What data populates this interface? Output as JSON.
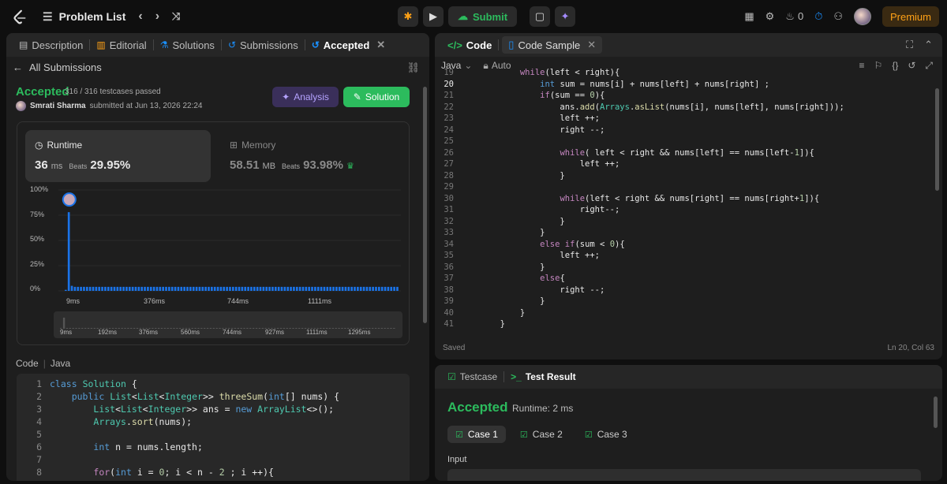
{
  "topbar": {
    "problem_list": "Problem List",
    "submit": "Submit",
    "streak": "0",
    "premium": "Premium"
  },
  "left": {
    "tabs": [
      {
        "label": "Description"
      },
      {
        "label": "Editorial"
      },
      {
        "label": "Solutions"
      },
      {
        "label": "Submissions"
      },
      {
        "label": "Accepted"
      }
    ],
    "back": "All Submissions",
    "status": "Accepted",
    "testcases": "316 / 316 testcases passed",
    "author": "Smrati Sharma",
    "submitted": "submitted at Jun 13, 2026 22:24",
    "analysis": "Analysis",
    "solution": "Solution",
    "runtime": {
      "label": "Runtime",
      "value": "36",
      "unit": "ms",
      "beats": "Beats",
      "pct": "29.95%"
    },
    "memory": {
      "label": "Memory",
      "value": "58.51",
      "unit": "MB",
      "beats": "Beats",
      "pct": "93.98%"
    },
    "code_label": "Code",
    "code_lang": "Java"
  },
  "chart_data": {
    "type": "bar",
    "y_tick_labels": [
      "100%",
      "75%",
      "50%",
      "25%",
      "0%"
    ],
    "x_tick_labels": [
      "9ms",
      "376ms",
      "744ms",
      "1111ms"
    ],
    "minimap_labels": [
      "9ms",
      "192ms",
      "376ms",
      "560ms",
      "744ms",
      "927ms",
      "1111ms",
      "1295ms"
    ],
    "ylim": [
      0,
      100
    ],
    "values": [
      1,
      78,
      5,
      4,
      4,
      4,
      4,
      4,
      4,
      4,
      4,
      4,
      4,
      4,
      4,
      4,
      4,
      4,
      4,
      4,
      4,
      4,
      4,
      4,
      4,
      4,
      4,
      4,
      4,
      4,
      4,
      4,
      4,
      4,
      4,
      4,
      4,
      4,
      4,
      4,
      4,
      4,
      4,
      4,
      4,
      4,
      4,
      4,
      4,
      4,
      4,
      4,
      4,
      4,
      4,
      4,
      4,
      4,
      4,
      4,
      4,
      4,
      4,
      4,
      4,
      4,
      4,
      4,
      4,
      4,
      4,
      4,
      4,
      4,
      4,
      4,
      4,
      4,
      4,
      4,
      4,
      4,
      4,
      4,
      4,
      4,
      4,
      4,
      4,
      4,
      4,
      4,
      4,
      4,
      4,
      4,
      4,
      4,
      4,
      4,
      4,
      4,
      4,
      4,
      4,
      4,
      4,
      4,
      4,
      4
    ],
    "highlight_index": 1,
    "bar_color": "#1a73e8"
  },
  "left_code": [
    {
      "n": "1",
      "t": "class Solution {"
    },
    {
      "n": "2",
      "t": "    public List<List<Integer>> threeSum(int[] nums) {"
    },
    {
      "n": "3",
      "t": "        List<List<Integer>> ans = new ArrayList<>();"
    },
    {
      "n": "4",
      "t": "        Arrays.sort(nums);"
    },
    {
      "n": "5",
      "t": ""
    },
    {
      "n": "6",
      "t": "        int n = nums.length;"
    },
    {
      "n": "7",
      "t": ""
    },
    {
      "n": "8",
      "t": "        for(int i = 0; i < n - 2 ; i ++){"
    }
  ],
  "right": {
    "tab_code": "Code",
    "tab_sample": "Code Sample",
    "lang": "Java",
    "mode": "Auto",
    "saved": "Saved",
    "cursor": "Ln 20, Col 63"
  },
  "editor": [
    {
      "n": "19",
      "t": "            while(left < right){"
    },
    {
      "n": "20",
      "t": "                int sum = nums[i] + nums[left] + nums[right] ;"
    },
    {
      "n": "21",
      "t": "                if(sum == 0){"
    },
    {
      "n": "22",
      "t": "                    ans.add(Arrays.asList(nums[i], nums[left], nums[right]));"
    },
    {
      "n": "23",
      "t": "                    left ++;"
    },
    {
      "n": "24",
      "t": "                    right --;"
    },
    {
      "n": "25",
      "t": ""
    },
    {
      "n": "26",
      "t": "                    while( left < right && nums[left] == nums[left-1]){"
    },
    {
      "n": "27",
      "t": "                        left ++;"
    },
    {
      "n": "28",
      "t": "                    }"
    },
    {
      "n": "29",
      "t": ""
    },
    {
      "n": "30",
      "t": "                    while(left < right && nums[right] == nums[right+1]){"
    },
    {
      "n": "31",
      "t": "                        right--;"
    },
    {
      "n": "32",
      "t": "                    }"
    },
    {
      "n": "33",
      "t": "                }"
    },
    {
      "n": "34",
      "t": "                else if(sum < 0){"
    },
    {
      "n": "35",
      "t": "                    left ++;"
    },
    {
      "n": "36",
      "t": "                }"
    },
    {
      "n": "37",
      "t": "                else{"
    },
    {
      "n": "38",
      "t": "                    right --;"
    },
    {
      "n": "39",
      "t": "                }"
    },
    {
      "n": "40",
      "t": "            }"
    },
    {
      "n": "41",
      "t": "        }"
    }
  ],
  "result": {
    "tab_testcase": "Testcase",
    "tab_result": "Test Result",
    "status": "Accepted",
    "runtime": "Runtime: 2 ms",
    "cases": [
      "Case 1",
      "Case 2",
      "Case 3"
    ],
    "input_label": "Input"
  }
}
